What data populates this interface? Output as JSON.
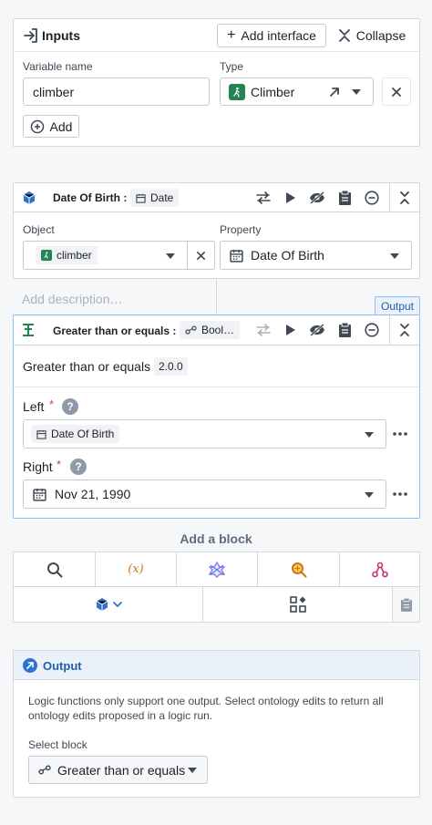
{
  "inputs": {
    "title": "Inputs",
    "add_interface_label": "Add interface",
    "collapse_label": "Collapse",
    "variable_name_label": "Variable name",
    "variable_name_value": "climber",
    "type_label": "Type",
    "type_value": "Climber",
    "add_label": "Add"
  },
  "dob_block": {
    "title": "Date Of Birth :",
    "type_tag": "Date",
    "object_label": "Object",
    "object_value": "climber",
    "property_label": "Property",
    "property_value": "Date Of Birth",
    "description_placeholder": "Add description…"
  },
  "gte_block": {
    "output_badge": "Output",
    "title": "Greater than or equals :",
    "type_tag": "Bool…",
    "func_name": "Greater than or equals",
    "version": "2.0.0",
    "left_label": "Left",
    "left_value": "Date Of Birth",
    "right_label": "Right",
    "right_value": "Nov 21, 1990",
    "required_mark": "*"
  },
  "add_block": {
    "title": "Add a block",
    "variable_glyph": "(x)"
  },
  "output": {
    "title": "Output",
    "description": "Logic functions only support one output. Select ontology edits to return all ontology edits proposed in a logic run.",
    "select_label": "Select block",
    "select_value": "Greater than or equals"
  },
  "colors": {
    "accent": "#2d72d2",
    "green": "#238551",
    "header_blue": "#ebf1f8",
    "required_red": "#cd4246",
    "variable_orange": "#c87619",
    "pink": "#c2307a",
    "purple": "#9179f2"
  }
}
